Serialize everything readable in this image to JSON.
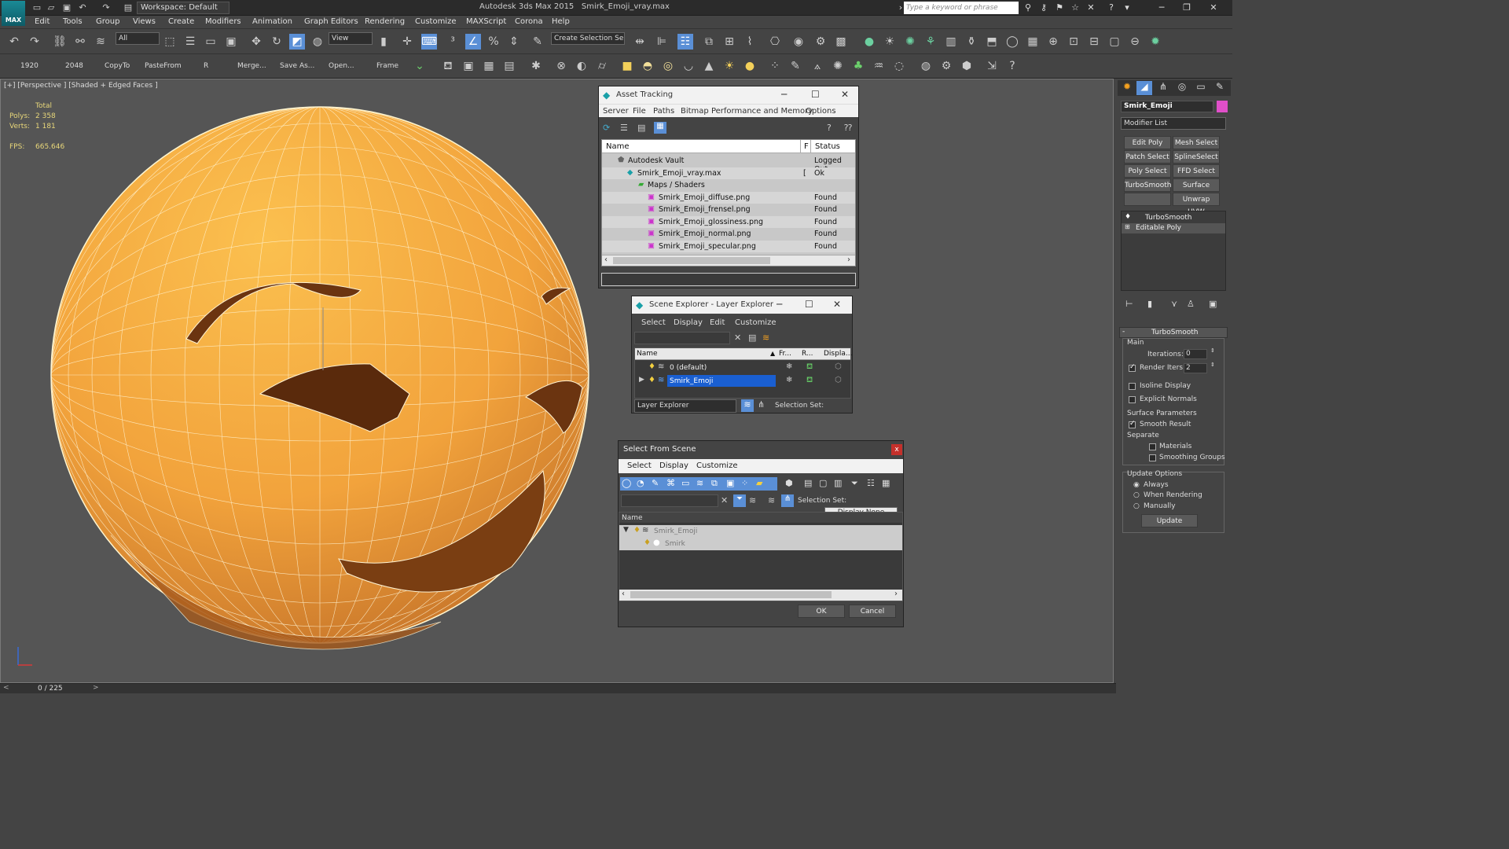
{
  "app": {
    "title": "Autodesk 3ds Max  2015",
    "file": "Smirk_Emoji_vray.max",
    "logo": "MAX",
    "workspace": "Workspace: Default",
    "search_placeholder": "Type a keyword or phrase"
  },
  "menus": [
    "Edit",
    "Tools",
    "Group",
    "Views",
    "Create",
    "Modifiers",
    "Animation",
    "Graph Editors",
    "Rendering",
    "Customize",
    "MAXScript",
    "Corona",
    "Help"
  ],
  "toolbar": {
    "filter": "All",
    "refcoord": "View",
    "selection_set": "Create Selection Se"
  },
  "toolbar2": [
    "1920",
    "2048",
    "CopyTo",
    "PasteFrom",
    "R",
    "Merge...",
    "Save As...",
    "Open...",
    "Frame"
  ],
  "viewport": {
    "label": "[+] [Perspective ] [Shaded + Edged Faces ]",
    "total": "Total",
    "polys_label": "Polys:",
    "polys": "2 358",
    "verts_label": "Verts:",
    "verts": "1 181",
    "fps_label": "FPS:",
    "fps": "665.646"
  },
  "asset_tracking": {
    "title": "Asset Tracking",
    "menus": [
      "Server",
      "File",
      "Paths",
      "Bitmap Performance and Memory",
      "Options"
    ],
    "columns": [
      "Name",
      "F",
      "Status"
    ],
    "rows": [
      {
        "name": "Autodesk Vault",
        "f": "",
        "status": "Logged Out"
      },
      {
        "name": "Smirk_Emoji_vray.max",
        "f": "[",
        "status": "Ok"
      },
      {
        "name": "Maps / Shaders",
        "f": "",
        "status": ""
      },
      {
        "name": "Smirk_Emoji_diffuse.png",
        "f": "",
        "status": "Found"
      },
      {
        "name": "Smirk_Emoji_frensel.png",
        "f": "",
        "status": "Found"
      },
      {
        "name": "Smirk_Emoji_glossiness.png",
        "f": "",
        "status": "Found"
      },
      {
        "name": "Smirk_Emoji_normal.png",
        "f": "",
        "status": "Found"
      },
      {
        "name": "Smirk_Emoji_specular.png",
        "f": "",
        "status": "Found"
      }
    ]
  },
  "scene_explorer": {
    "title": "Scene Explorer - Layer Explorer",
    "menus": [
      "Select",
      "Display",
      "Edit",
      "Customize"
    ],
    "columns": [
      "Name",
      "Fr...",
      "R...",
      "Displa..."
    ],
    "rows": [
      "0 (default)",
      "Smirk_Emoji"
    ],
    "footer_dd": "Layer Explorer",
    "selection_set": "Selection Set:"
  },
  "select_from_scene": {
    "title": "Select From Scene",
    "menus": [
      "Select",
      "Display",
      "Customize"
    ],
    "selection_set": "Selection Set:",
    "tooltip": "Display None",
    "column": "Name",
    "rows": [
      "Smirk_Emoji",
      "Smirk"
    ],
    "ok": "OK",
    "cancel": "Cancel"
  },
  "command_panel": {
    "object_name": "Smirk_Emoji",
    "modifier_list": "Modifier List",
    "buttons": [
      "Edit Poly",
      "Mesh Select",
      "Patch Select",
      "SplineSelect",
      "Poly Select",
      "FFD Select",
      "TurboSmooth",
      "Surface Select",
      "",
      "Unwrap UVW"
    ],
    "stack": [
      "TurboSmooth",
      "Editable Poly"
    ],
    "rollout": "TurboSmooth",
    "main": "Main",
    "iterations_label": "Iterations:",
    "iterations": "0",
    "render_iters_label": "Render Iters:",
    "render_iters": "2",
    "isoline": "Isoline Display",
    "explicit": "Explicit Normals",
    "surface": "Surface Parameters",
    "smooth": "Smooth Result",
    "separate": "Separate",
    "materials": "Materials",
    "smoothing": "Smoothing Groups",
    "update_options": "Update Options",
    "always": "Always",
    "when_rendering": "When Rendering",
    "manually": "Manually",
    "update": "Update"
  },
  "status": {
    "frames": "0 / 225"
  },
  "colors": {
    "accent": "#0e6fd6",
    "selection": "#1a5fd1",
    "face": "#f4b040"
  }
}
